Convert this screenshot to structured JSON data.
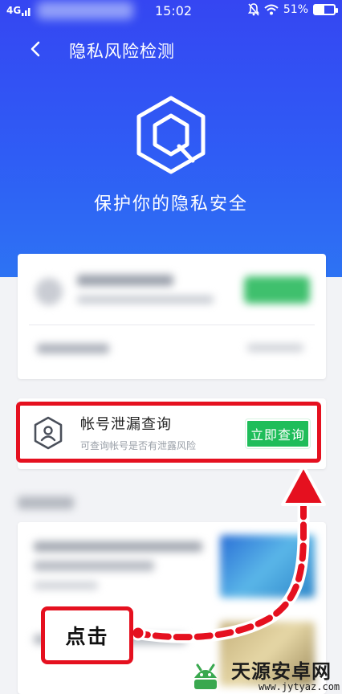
{
  "status_bar": {
    "network": "4G",
    "time": "15:02",
    "battery": "51%",
    "battery_level": 0.51
  },
  "header": {
    "title": "隐私风险检测",
    "subtitle": "保护你的隐私安全"
  },
  "leak_check": {
    "title": "帐号泄漏查询",
    "description": "可查询帐号是否有泄露风险",
    "button_label": "立即查询"
  },
  "annotation": {
    "click_label": "点击",
    "highlight_color": "#e5101f"
  },
  "watermark": {
    "name": "天源安卓网",
    "url": "www.jytyaz.com"
  },
  "colors": {
    "header_blue": "#3546f2",
    "button_green": "#1fbd5a"
  }
}
